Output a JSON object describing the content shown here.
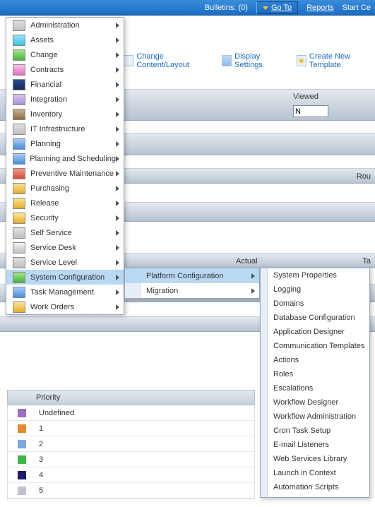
{
  "header": {
    "bulletins": "Bulletins: (0)",
    "go_to": "Go To",
    "reports": "Reports",
    "start": "Start Ce"
  },
  "toolbar": {
    "change_content": "Change Content/Layout",
    "display_settings": "Display Settings",
    "create_template": "Create New Template"
  },
  "sections": {
    "viewed_label": "Viewed",
    "viewed_value": "N",
    "rou": "Rou",
    "actual": "Actual",
    "ta": "Ta"
  },
  "main_menu": [
    {
      "label": "Administration",
      "icon": "grey"
    },
    {
      "label": "Assets",
      "icon": "cyan"
    },
    {
      "label": "Change",
      "icon": "green"
    },
    {
      "label": "Contracts",
      "icon": "pink"
    },
    {
      "label": "Financial",
      "icon": "navy"
    },
    {
      "label": "Integration",
      "icon": "lav"
    },
    {
      "label": "Inventory",
      "icon": "brown"
    },
    {
      "label": "IT Infrastructure",
      "icon": "grey"
    },
    {
      "label": "Planning",
      "icon": "blue"
    },
    {
      "label": "Planning and Scheduling",
      "icon": "blue"
    },
    {
      "label": "Preventive Maintenance",
      "icon": "red"
    },
    {
      "label": "Purchasing",
      "icon": "gold"
    },
    {
      "label": "Release",
      "icon": "gold"
    },
    {
      "label": "Security",
      "icon": "gold"
    },
    {
      "label": "Self Service",
      "icon": "grey"
    },
    {
      "label": "Service Desk",
      "icon": "silver"
    },
    {
      "label": "Service Level",
      "icon": "grey"
    },
    {
      "label": "System Configuration",
      "icon": "green",
      "selected": true
    },
    {
      "label": "Task Management",
      "icon": "blue"
    },
    {
      "label": "Work Orders",
      "icon": "gold"
    }
  ],
  "sub_menu": [
    {
      "label": "Platform Configuration",
      "selected": true
    },
    {
      "label": "Migration"
    }
  ],
  "leaf_menu": [
    "System Properties",
    "Logging",
    "Domains",
    "Database Configuration",
    "Application Designer",
    "Communication Templates",
    "Actions",
    "Roles",
    "Escalations",
    "Workflow Designer",
    "Workflow Administration",
    "Cron Task Setup",
    "E-mail Listeners",
    "Web Services Library",
    "Launch in Context",
    "Automation Scripts"
  ],
  "priority": {
    "header": "Priority",
    "rows": [
      {
        "label": "Undefined",
        "color": "#9c6fb8"
      },
      {
        "label": "1",
        "color": "#e78a2e"
      },
      {
        "label": "2",
        "color": "#7fa8e0"
      },
      {
        "label": "3",
        "color": "#3fb648"
      },
      {
        "label": "4",
        "color": "#1b1e66"
      },
      {
        "label": "5",
        "color": "#bfc3cc"
      }
    ]
  }
}
